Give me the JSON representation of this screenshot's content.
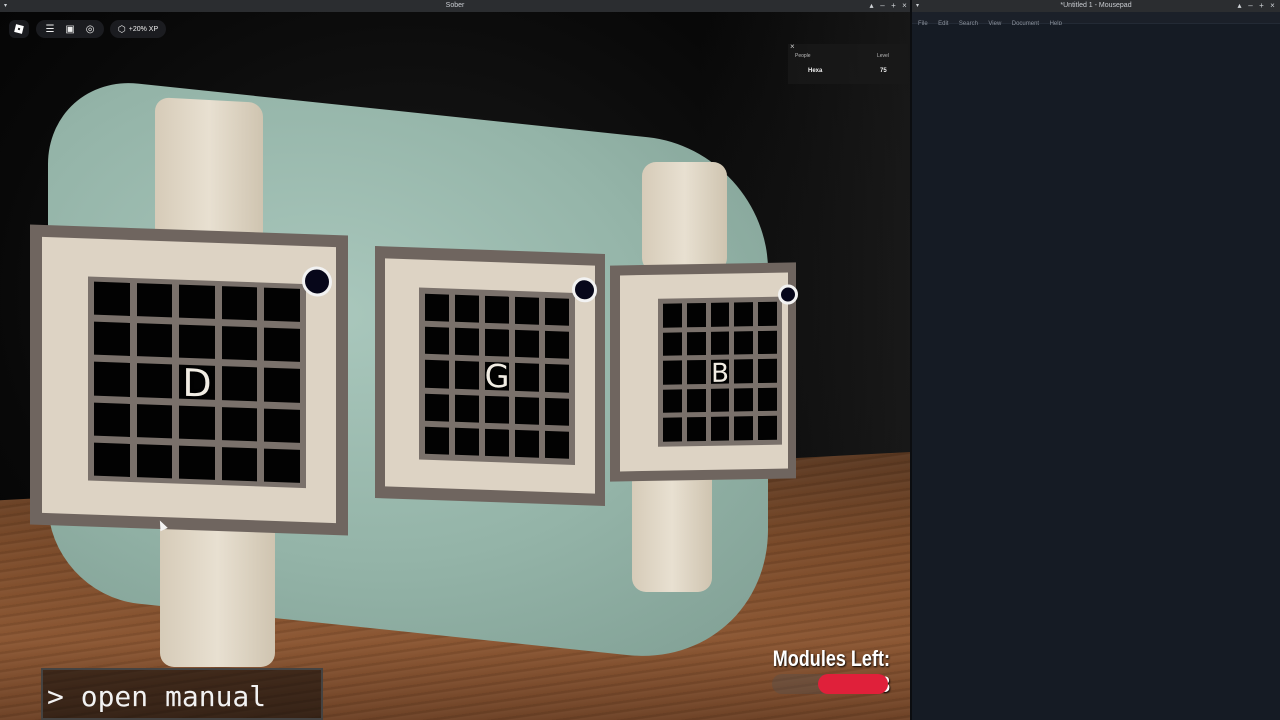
{
  "sober_window": {
    "title": "Sober",
    "controls": [
      "▴",
      "–",
      "+",
      "×"
    ]
  },
  "mousepad_window": {
    "title": "*Untitled 1 - Mousepad",
    "controls": [
      "▴",
      "–",
      "+",
      "×"
    ],
    "menu": [
      "File",
      "Edit",
      "Search",
      "View",
      "Document",
      "Help"
    ]
  },
  "roblox_topbar": {
    "roblox_icon": "roblox-logo-icon",
    "menu_icon": "hamburger-menu-icon",
    "chat_icon": "chat-icon",
    "headset_icon": "headset-icon",
    "xp_label": "+20% XP"
  },
  "leaderboard": {
    "columns": [
      "People",
      "Level"
    ],
    "rows": [
      {
        "name": "Hexa",
        "level": "75"
      }
    ],
    "close_icon": "close-icon"
  },
  "modules": [
    {
      "letter": "D",
      "led_color": "#07071a"
    },
    {
      "letter": "G",
      "led_color": "#07071a"
    },
    {
      "letter": "B",
      "led_color": "#07071a"
    }
  ],
  "hud": {
    "modules_left": "Modules Left: 3",
    "progress_fraction": 0.6,
    "progress_color": "#e0203a"
  },
  "command": {
    "text": "> open manual"
  }
}
